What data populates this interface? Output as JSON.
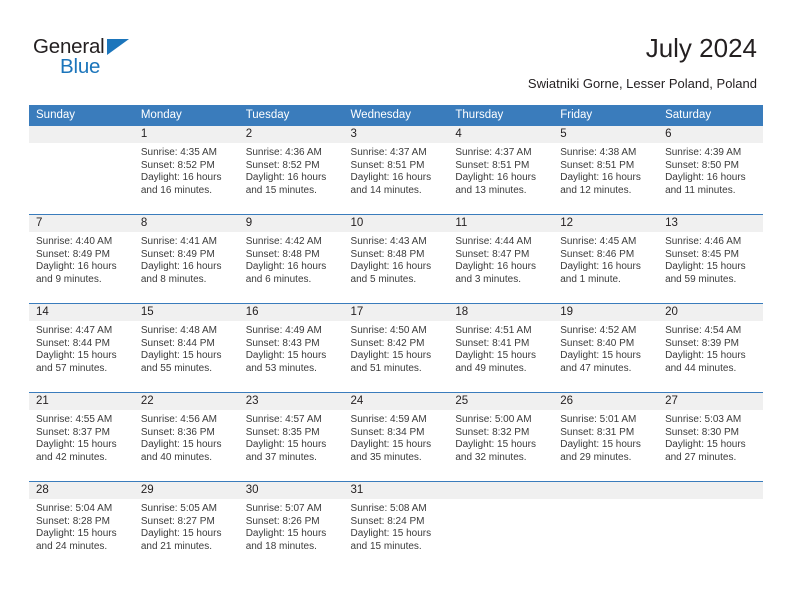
{
  "brand": {
    "name_top": "General",
    "name_bottom": "Blue",
    "accent_color": "#1b75bb"
  },
  "header": {
    "title": "July 2024",
    "subtitle": "Swiatniki Gorne, Lesser Poland, Poland"
  },
  "calendar": {
    "header_bg": "#3a7cbc",
    "daynum_bg": "#f0f0f0",
    "weekday_headers": [
      "Sunday",
      "Monday",
      "Tuesday",
      "Wednesday",
      "Thursday",
      "Friday",
      "Saturday"
    ],
    "weeks": [
      [
        {
          "day": "",
          "blank": true,
          "sunrise": "",
          "sunset": "",
          "daylight1": "",
          "daylight2": ""
        },
        {
          "day": "1",
          "sunrise": "Sunrise: 4:35 AM",
          "sunset": "Sunset: 8:52 PM",
          "daylight1": "Daylight: 16 hours",
          "daylight2": "and 16 minutes."
        },
        {
          "day": "2",
          "sunrise": "Sunrise: 4:36 AM",
          "sunset": "Sunset: 8:52 PM",
          "daylight1": "Daylight: 16 hours",
          "daylight2": "and 15 minutes."
        },
        {
          "day": "3",
          "sunrise": "Sunrise: 4:37 AM",
          "sunset": "Sunset: 8:51 PM",
          "daylight1": "Daylight: 16 hours",
          "daylight2": "and 14 minutes."
        },
        {
          "day": "4",
          "sunrise": "Sunrise: 4:37 AM",
          "sunset": "Sunset: 8:51 PM",
          "daylight1": "Daylight: 16 hours",
          "daylight2": "and 13 minutes."
        },
        {
          "day": "5",
          "sunrise": "Sunrise: 4:38 AM",
          "sunset": "Sunset: 8:51 PM",
          "daylight1": "Daylight: 16 hours",
          "daylight2": "and 12 minutes."
        },
        {
          "day": "6",
          "sunrise": "Sunrise: 4:39 AM",
          "sunset": "Sunset: 8:50 PM",
          "daylight1": "Daylight: 16 hours",
          "daylight2": "and 11 minutes."
        }
      ],
      [
        {
          "day": "7",
          "sunrise": "Sunrise: 4:40 AM",
          "sunset": "Sunset: 8:49 PM",
          "daylight1": "Daylight: 16 hours",
          "daylight2": "and 9 minutes."
        },
        {
          "day": "8",
          "sunrise": "Sunrise: 4:41 AM",
          "sunset": "Sunset: 8:49 PM",
          "daylight1": "Daylight: 16 hours",
          "daylight2": "and 8 minutes."
        },
        {
          "day": "9",
          "sunrise": "Sunrise: 4:42 AM",
          "sunset": "Sunset: 8:48 PM",
          "daylight1": "Daylight: 16 hours",
          "daylight2": "and 6 minutes."
        },
        {
          "day": "10",
          "sunrise": "Sunrise: 4:43 AM",
          "sunset": "Sunset: 8:48 PM",
          "daylight1": "Daylight: 16 hours",
          "daylight2": "and 5 minutes."
        },
        {
          "day": "11",
          "sunrise": "Sunrise: 4:44 AM",
          "sunset": "Sunset: 8:47 PM",
          "daylight1": "Daylight: 16 hours",
          "daylight2": "and 3 minutes."
        },
        {
          "day": "12",
          "sunrise": "Sunrise: 4:45 AM",
          "sunset": "Sunset: 8:46 PM",
          "daylight1": "Daylight: 16 hours",
          "daylight2": "and 1 minute."
        },
        {
          "day": "13",
          "sunrise": "Sunrise: 4:46 AM",
          "sunset": "Sunset: 8:45 PM",
          "daylight1": "Daylight: 15 hours",
          "daylight2": "and 59 minutes."
        }
      ],
      [
        {
          "day": "14",
          "sunrise": "Sunrise: 4:47 AM",
          "sunset": "Sunset: 8:44 PM",
          "daylight1": "Daylight: 15 hours",
          "daylight2": "and 57 minutes."
        },
        {
          "day": "15",
          "sunrise": "Sunrise: 4:48 AM",
          "sunset": "Sunset: 8:44 PM",
          "daylight1": "Daylight: 15 hours",
          "daylight2": "and 55 minutes."
        },
        {
          "day": "16",
          "sunrise": "Sunrise: 4:49 AM",
          "sunset": "Sunset: 8:43 PM",
          "daylight1": "Daylight: 15 hours",
          "daylight2": "and 53 minutes."
        },
        {
          "day": "17",
          "sunrise": "Sunrise: 4:50 AM",
          "sunset": "Sunset: 8:42 PM",
          "daylight1": "Daylight: 15 hours",
          "daylight2": "and 51 minutes."
        },
        {
          "day": "18",
          "sunrise": "Sunrise: 4:51 AM",
          "sunset": "Sunset: 8:41 PM",
          "daylight1": "Daylight: 15 hours",
          "daylight2": "and 49 minutes."
        },
        {
          "day": "19",
          "sunrise": "Sunrise: 4:52 AM",
          "sunset": "Sunset: 8:40 PM",
          "daylight1": "Daylight: 15 hours",
          "daylight2": "and 47 minutes."
        },
        {
          "day": "20",
          "sunrise": "Sunrise: 4:54 AM",
          "sunset": "Sunset: 8:39 PM",
          "daylight1": "Daylight: 15 hours",
          "daylight2": "and 44 minutes."
        }
      ],
      [
        {
          "day": "21",
          "sunrise": "Sunrise: 4:55 AM",
          "sunset": "Sunset: 8:37 PM",
          "daylight1": "Daylight: 15 hours",
          "daylight2": "and 42 minutes."
        },
        {
          "day": "22",
          "sunrise": "Sunrise: 4:56 AM",
          "sunset": "Sunset: 8:36 PM",
          "daylight1": "Daylight: 15 hours",
          "daylight2": "and 40 minutes."
        },
        {
          "day": "23",
          "sunrise": "Sunrise: 4:57 AM",
          "sunset": "Sunset: 8:35 PM",
          "daylight1": "Daylight: 15 hours",
          "daylight2": "and 37 minutes."
        },
        {
          "day": "24",
          "sunrise": "Sunrise: 4:59 AM",
          "sunset": "Sunset: 8:34 PM",
          "daylight1": "Daylight: 15 hours",
          "daylight2": "and 35 minutes."
        },
        {
          "day": "25",
          "sunrise": "Sunrise: 5:00 AM",
          "sunset": "Sunset: 8:32 PM",
          "daylight1": "Daylight: 15 hours",
          "daylight2": "and 32 minutes."
        },
        {
          "day": "26",
          "sunrise": "Sunrise: 5:01 AM",
          "sunset": "Sunset: 8:31 PM",
          "daylight1": "Daylight: 15 hours",
          "daylight2": "and 29 minutes."
        },
        {
          "day": "27",
          "sunrise": "Sunrise: 5:03 AM",
          "sunset": "Sunset: 8:30 PM",
          "daylight1": "Daylight: 15 hours",
          "daylight2": "and 27 minutes."
        }
      ],
      [
        {
          "day": "28",
          "sunrise": "Sunrise: 5:04 AM",
          "sunset": "Sunset: 8:28 PM",
          "daylight1": "Daylight: 15 hours",
          "daylight2": "and 24 minutes."
        },
        {
          "day": "29",
          "sunrise": "Sunrise: 5:05 AM",
          "sunset": "Sunset: 8:27 PM",
          "daylight1": "Daylight: 15 hours",
          "daylight2": "and 21 minutes."
        },
        {
          "day": "30",
          "sunrise": "Sunrise: 5:07 AM",
          "sunset": "Sunset: 8:26 PM",
          "daylight1": "Daylight: 15 hours",
          "daylight2": "and 18 minutes."
        },
        {
          "day": "31",
          "sunrise": "Sunrise: 5:08 AM",
          "sunset": "Sunset: 8:24 PM",
          "daylight1": "Daylight: 15 hours",
          "daylight2": "and 15 minutes."
        },
        {
          "day": "",
          "blank": true,
          "sunrise": "",
          "sunset": "",
          "daylight1": "",
          "daylight2": ""
        },
        {
          "day": "",
          "blank": true,
          "sunrise": "",
          "sunset": "",
          "daylight1": "",
          "daylight2": ""
        },
        {
          "day": "",
          "blank": true,
          "sunrise": "",
          "sunset": "",
          "daylight1": "",
          "daylight2": ""
        }
      ]
    ]
  }
}
